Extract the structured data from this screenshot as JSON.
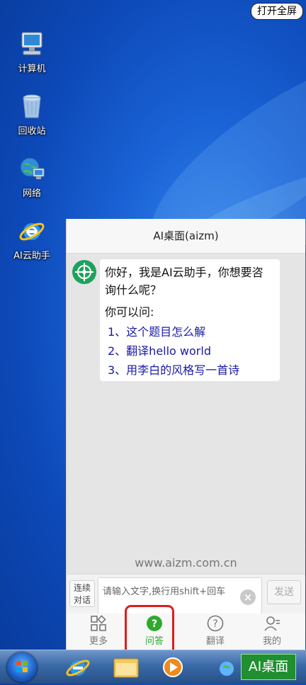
{
  "desktop": {
    "fullscreen_button": "打开全屏",
    "icons": [
      {
        "label": "计算机",
        "icon": "computer-icon"
      },
      {
        "label": "回收站",
        "icon": "recycle-bin-icon"
      },
      {
        "label": "网络",
        "icon": "network-icon"
      },
      {
        "label": "AI云助手",
        "icon": "ie-icon"
      }
    ]
  },
  "panel": {
    "title": "AI桌面(aizm)",
    "greeting": "你好，我是AI云助手，你想要咨询什么呢？",
    "ask_label": "你可以问:",
    "questions": [
      "1、这个题目怎么解",
      "2、翻译hello world",
      "3、用李白的风格写一首诗"
    ],
    "watermark": "www.aizm.com.cn",
    "continuous_button": "连续对话",
    "input_placeholder": "请输入文字,换行用shift+回车",
    "send_button": "发送",
    "tabs": [
      {
        "label": "更多",
        "icon": "grid-icon",
        "active": false
      },
      {
        "label": "问答",
        "icon": "question-icon",
        "active": true
      },
      {
        "label": "翻译",
        "icon": "question-outline-icon",
        "active": false
      },
      {
        "label": "我的",
        "icon": "user-icon",
        "active": false
      }
    ]
  },
  "taskbar": {
    "ai_badge": "AI桌面"
  },
  "colors": {
    "accent_green": "#2eaa2e",
    "question_blue": "#1a1aa8",
    "highlight_red": "#e01d1d"
  }
}
